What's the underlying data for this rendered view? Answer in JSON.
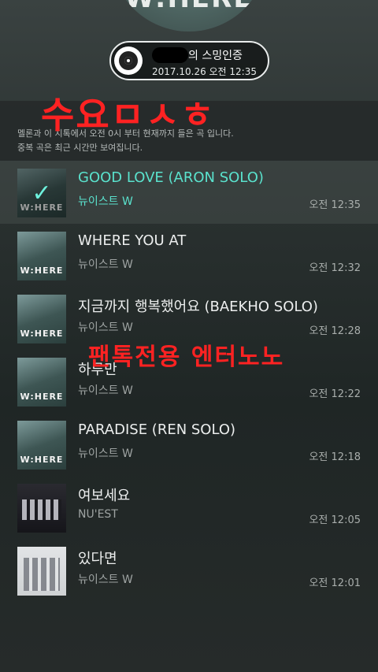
{
  "header": {
    "album_art_text": "W:HERE",
    "badge_title": "의 스밍인증",
    "badge_date": "2017.10.26 오전 12:35"
  },
  "info": {
    "line1": "멜론과 이 지톡에서 오전 0시 부터 현재까지 들은 곡 입니다.",
    "line2": "중복 곡은 최근 시간만 보여집니다."
  },
  "overlays": {
    "top": "수요ㅁㅅㅎ",
    "middle": "팬톡전용 엔터노노"
  },
  "tracks": [
    {
      "title": "GOOD LOVE (ARON SOLO)",
      "artist": "뉴이스트 W",
      "time": "오전 12:35",
      "art": "W:HERE"
    },
    {
      "title": "WHERE YOU AT",
      "artist": "뉴이스트 W",
      "time": "오전 12:32",
      "art": "W:HERE"
    },
    {
      "title": "지금까지 행복했어요 (BAEKHO SOLO)",
      "artist": "뉴이스트 W",
      "time": "오전 12:28",
      "art": "W:HERE"
    },
    {
      "title": "하루만",
      "artist": "뉴이스트 W",
      "time": "오전 12:22",
      "art": "W:HERE"
    },
    {
      "title": "PARADISE (REN SOLO)",
      "artist": "뉴이스트 W",
      "time": "오전 12:18",
      "art": "W:HERE"
    },
    {
      "title": "여보세요",
      "artist": "NU'EST",
      "time": "오전 12:05"
    },
    {
      "title": "있다면",
      "artist": "뉴이스트 W",
      "time": "오전 12:01"
    }
  ],
  "colors": {
    "accent": "#5ae2cd",
    "overlay_red": "#ff2222"
  }
}
